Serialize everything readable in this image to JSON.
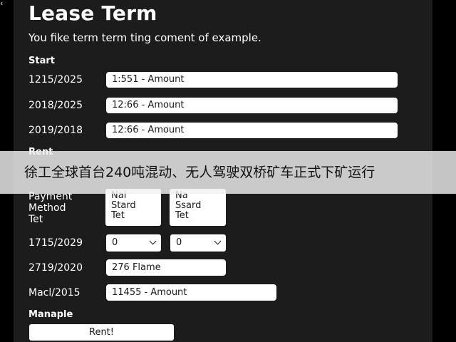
{
  "corner_icon": "back-chevron-icon",
  "title": "Lease Term",
  "subtitle": "You fike term term ting coment of example.",
  "start_section": "Start",
  "start_rows": [
    {
      "label": "1215/2025",
      "value": "1:551 - Amount"
    },
    {
      "label": "2018/2025",
      "value": "12:66 - Amount"
    },
    {
      "label": "2019/2018",
      "value": "12:66 - Amount"
    }
  ],
  "rent_section": "Rent",
  "banner_text": "徐工全球首台240吨混动、无人驾驶双桥矿车正式下矿运行",
  "payment": {
    "label": [
      "Payment",
      "Method",
      "Tet"
    ],
    "card_1": [
      "Nal",
      "Stard",
      "Tet"
    ],
    "card_2": [
      "Na",
      "Ssard",
      "Tet"
    ]
  },
  "select_row": {
    "label": "1715/2029",
    "select_1_value": "0",
    "select_2_value": "0"
  },
  "flame_row": {
    "label": "2719/2020",
    "value": "276 Flame"
  },
  "amount_row": {
    "label": "Macl/2015",
    "value": "11455 - Amount"
  },
  "manaple_section": "Manaple",
  "button_label": "Rent!"
}
